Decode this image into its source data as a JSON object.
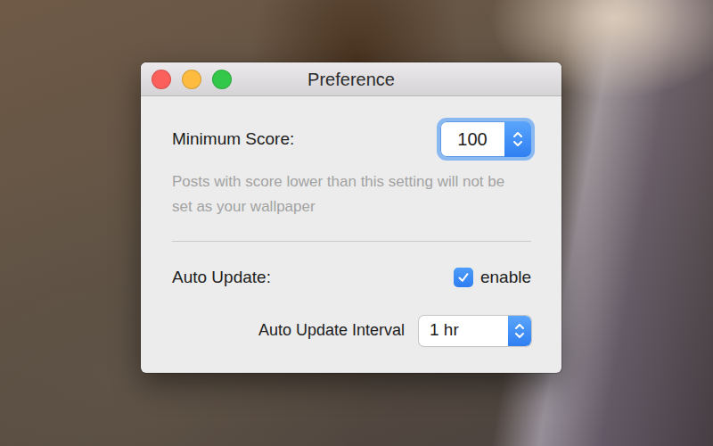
{
  "window": {
    "title": "Preference"
  },
  "traffic_lights": [
    {
      "kind": "close",
      "color": "#fc605c"
    },
    {
      "kind": "minimize",
      "color": "#fdbc40"
    },
    {
      "kind": "zoom",
      "color": "#34c84a"
    }
  ],
  "minimum_score": {
    "label": "Minimum Score:",
    "value": "100",
    "hint": "Posts with score lower than this setting will not be set as your wallpaper"
  },
  "auto_update": {
    "label": "Auto Update:",
    "checkbox_label": "enable",
    "checked": true
  },
  "auto_update_interval": {
    "label": "Auto Update Interval",
    "value": "1 hr"
  }
}
